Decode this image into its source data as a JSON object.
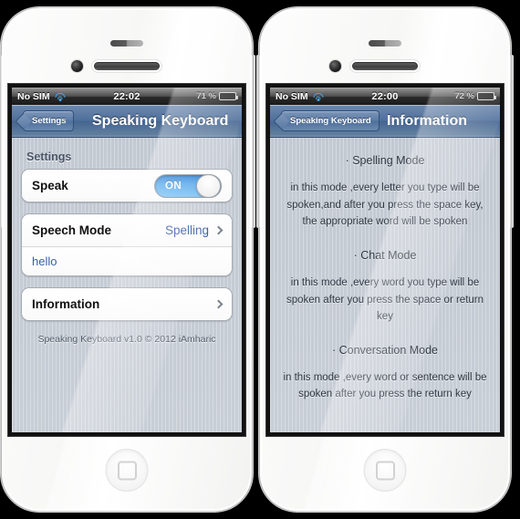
{
  "left_phone": {
    "status_bar": {
      "carrier": "No SIM",
      "wifi_icon": "wifi-icon",
      "time": "22:02",
      "battery_pct": "71 %",
      "battery_icon": "battery-icon"
    },
    "nav": {
      "back_label": "Settings",
      "title": "Speaking Keyboard"
    },
    "settings": {
      "section_header": "Settings",
      "speak_label": "Speak",
      "speak_toggle": "ON",
      "speech_mode_label": "Speech Mode",
      "speech_mode_value": "Spelling",
      "text_value": "hello",
      "information_label": "Information",
      "footer": "Speaking Keyboard v1.0 © 2012 iAmharic"
    }
  },
  "right_phone": {
    "status_bar": {
      "carrier": "No SIM",
      "wifi_icon": "wifi-icon",
      "time": "22:00",
      "battery_pct": "72 %",
      "battery_icon": "battery-icon"
    },
    "nav": {
      "back_label": "Speaking Keyboard",
      "title": "Information"
    },
    "info": {
      "sections": [
        {
          "heading": "· Spelling Mode",
          "body": "in this mode ,every letter you type will be spoken,and after you press the space key, the  appropriate word will be spoken"
        },
        {
          "heading": "· Chat Mode",
          "body": "in this mode ,every word you type will be spoken after you press the space or return key"
        },
        {
          "heading": "· Conversation Mode",
          "body": "in this mode ,every word or sentence will be spoken after you press the return key"
        }
      ]
    }
  },
  "colors": {
    "accent_blue": "#3a5fa8",
    "toggle_on": "#56a7ea",
    "navbar": "#4f6f9b",
    "battery_green": "#57c038"
  }
}
